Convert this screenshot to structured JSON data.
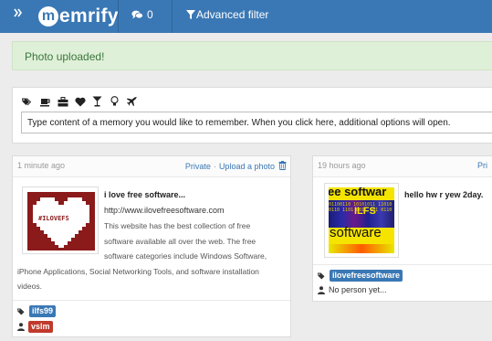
{
  "navbar": {
    "brand_initial": "m",
    "brand_rest": "emrify",
    "toggle_icon": "double-chevron-right-icon",
    "messages_count": "0",
    "filter_label": "Advanced filter"
  },
  "alert": {
    "text": "Photo uploaded!"
  },
  "composer": {
    "placeholder": "Type content of a memory you would like to remember. When you click here, additional options will open.",
    "category_icons": [
      "tags-icon",
      "coffee-icon",
      "briefcase-icon",
      "heart-icon",
      "glass-icon",
      "lightbulb-icon",
      "plane-icon"
    ]
  },
  "memories": [
    {
      "time": "1 minute ago",
      "privacy": "Private",
      "upload_action": "Upload a photo",
      "title": "i love free software...",
      "url": "http://www.ilovefreesoftware.com",
      "description_lines": [
        "This website has the best collection of free",
        "software available all over the web. The free",
        "software categories include Windows Software,",
        "iPhone Applications, Social Networking Tools, and software installation",
        "videos."
      ],
      "thumbnail_text": "#ILOVEFS",
      "tag": "ilfs99",
      "person": "vslm"
    },
    {
      "time": "19 hours ago",
      "privacy": "Pri",
      "title": "hello hw r yew 2day.",
      "thumbnail_text_top": "ee softwar",
      "thumbnail_text_mid": "ILFS",
      "thumbnail_text_bottom": "software",
      "tag": "ilovefreesoftware",
      "no_person": "No person yet..."
    }
  ],
  "colors": {
    "navbar": "#3a78b5",
    "alert_bg": "#dff0d8",
    "alert_text": "#3c763d",
    "tag_label": "#3a78b5",
    "person_label": "#c0392b"
  }
}
